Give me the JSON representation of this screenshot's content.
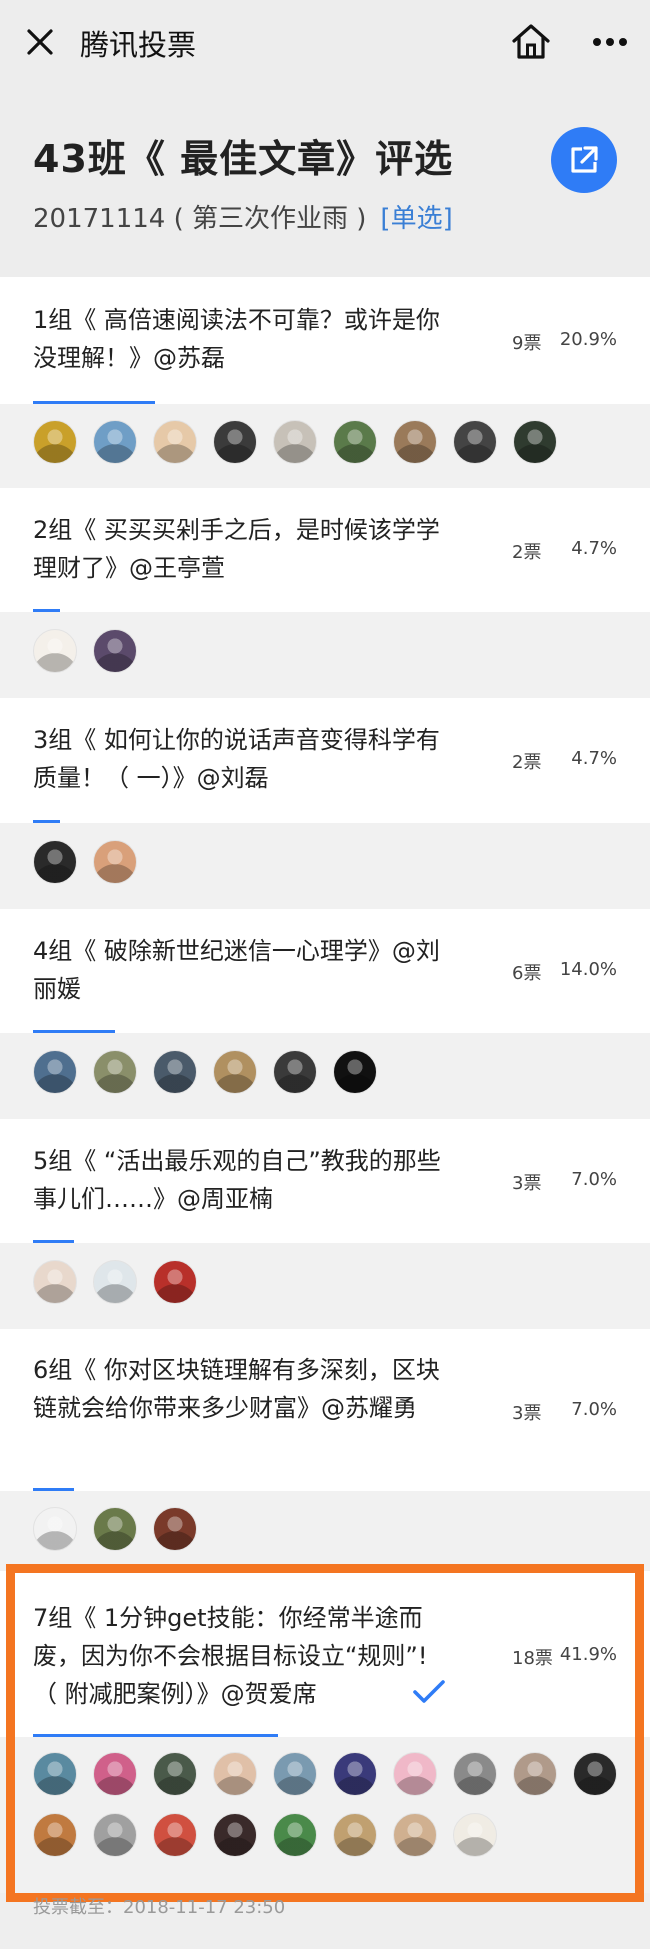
{
  "nav": {
    "title": "腾讯投票",
    "icons": [
      "close-icon",
      "home-icon",
      "more-icon"
    ]
  },
  "header": {
    "title": "43班《 最佳文章》评选",
    "subtitle": "20171114 ( 第三次作业雨 )",
    "mode": "[单选]",
    "share_icon": "share-icon"
  },
  "colors": {
    "accent": "#2f7cf6",
    "highlight": "#f47521",
    "mode_text": "#3a7fd5"
  },
  "options": [
    {
      "text": "1组《 高倍速阅读法不可靠？或许是你没理解！》@苏磊",
      "votes": "9票",
      "percent": "20.9%",
      "share": 0.209,
      "voter_count": 9
    },
    {
      "text": "2组《 买买买剁手之后，是时候该学学理财了》@王亭萱",
      "votes": "2票",
      "percent": "4.7%",
      "share": 0.047,
      "voter_count": 2
    },
    {
      "text": "3组《 如何让你的说话声音变得科学有质量！（ 一）》@刘磊",
      "votes": "2票",
      "percent": "4.7%",
      "share": 0.047,
      "voter_count": 2
    },
    {
      "text": "4组《 破除新世纪迷信一心理学》@刘丽媛",
      "votes": "6票",
      "percent": "14.0%",
      "share": 0.14,
      "voter_count": 6
    },
    {
      "text": "5组《 “活出最乐观的自己”教我的那些事儿们……》@周亚楠",
      "votes": "3票",
      "percent": "7.0%",
      "share": 0.07,
      "voter_count": 3
    },
    {
      "text": "6组《 你对区块链理解有多深刻，区块链就会给你带来多少财富》@苏耀勇",
      "votes": "3票",
      "percent": "7.0%",
      "share": 0.07,
      "voter_count": 3
    },
    {
      "text": "7组《 1分钟get技能：你经常半途而废，因为你不会根据目标设立“规则”!（ 附减肥案例）》@贺爱席",
      "votes": "18票",
      "percent": "41.9%",
      "share": 0.419,
      "voter_count": 18,
      "selected": true
    }
  ],
  "footer": {
    "deadline": "投票截至：2018-11-17 23:50"
  }
}
